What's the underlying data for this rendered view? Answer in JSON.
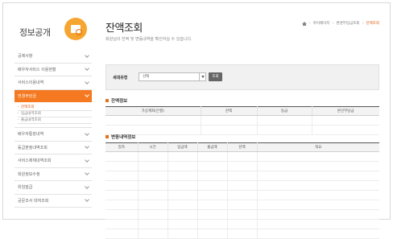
{
  "sidebar": {
    "title": "정보공개",
    "items": [
      {
        "label": "공제사항"
      },
      {
        "label": "배우자서비스 이용현황"
      },
      {
        "label": "서비스이용내역"
      },
      {
        "label": "변경부담금",
        "active": true,
        "sub": [
          {
            "label": "잔액조회",
            "current": true
          },
          {
            "label": "입금내역조회"
          },
          {
            "label": "출금내역조회"
          }
        ]
      },
      {
        "label": "배우자통장내역"
      },
      {
        "label": "등급판정내역조회"
      },
      {
        "label": "서비스제재내역조회"
      },
      {
        "label": "회원정보수정"
      },
      {
        "label": "위임발급"
      },
      {
        "label": "공문조서 대여조회"
      }
    ]
  },
  "header": {
    "title": "잔액조회",
    "description": "회원님의 잔액 및 변동내역을 확인하실 수 있습니다.",
    "breadcrumb": [
      "마이페이지",
      "변경부담금조회",
      "잔액조회"
    ]
  },
  "search": {
    "label": "세대유형",
    "select_value": "선택",
    "button_label": "조회"
  },
  "balance_section": {
    "title": "잔액정보",
    "columns": [
      "가상계좌(은행)",
      "잔액",
      "등급",
      "본인부담금"
    ],
    "rows": [
      [
        "",
        "",
        "",
        ""
      ],
      [
        "",
        "",
        "",
        ""
      ]
    ]
  },
  "history_section": {
    "title": "변동내역정보",
    "columns": [
      "일자",
      "시간",
      "입금액",
      "출금액",
      "잔액",
      "적요"
    ],
    "rows": [
      [
        "",
        "",
        "",
        "",
        "",
        ""
      ],
      [
        "",
        "",
        "",
        "",
        "",
        ""
      ],
      [
        "",
        "",
        "",
        "",
        "",
        ""
      ],
      [
        "",
        "",
        "",
        "",
        "",
        ""
      ],
      [
        "",
        "",
        "",
        "",
        "",
        ""
      ],
      [
        "",
        "",
        "",
        "",
        "",
        ""
      ],
      [
        "",
        "",
        "",
        "",
        "",
        ""
      ],
      [
        "",
        "",
        "",
        "",
        "",
        ""
      ],
      [
        "",
        "",
        "",
        "",
        "",
        ""
      ]
    ]
  },
  "colors": {
    "accent": "#f47920",
    "logo": "#f6a530"
  }
}
